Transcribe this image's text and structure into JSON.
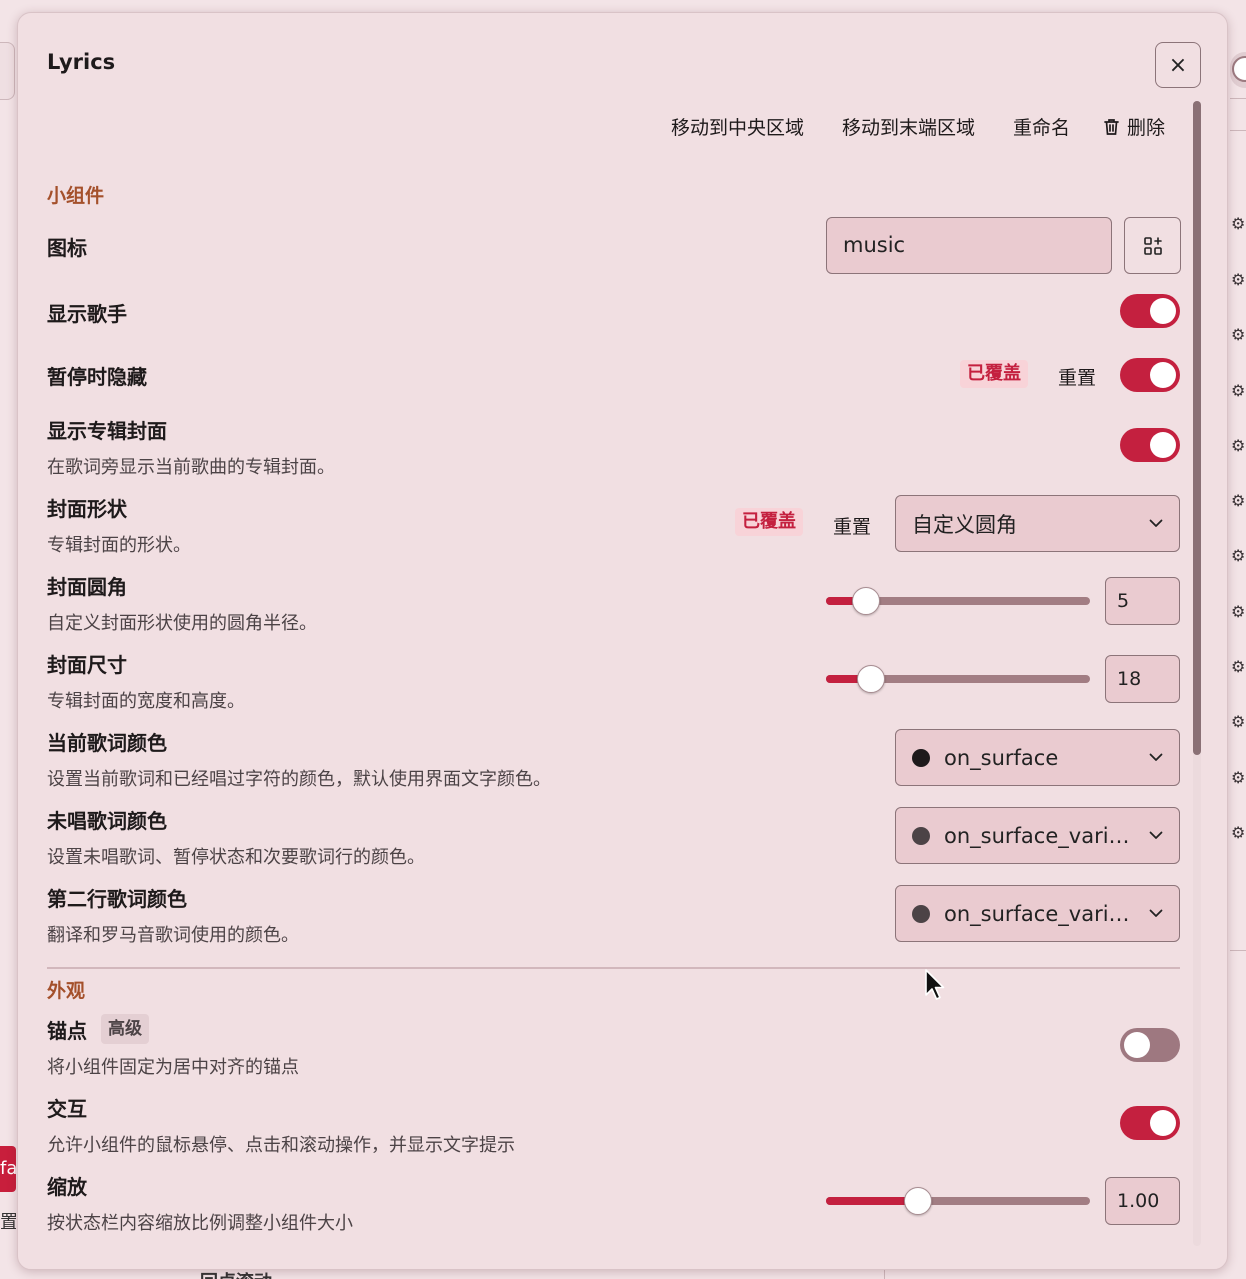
{
  "dialog": {
    "title": "Lyrics",
    "close_label": "×"
  },
  "actions": {
    "move_center": "移动到中央区域",
    "move_end": "移动到末端区域",
    "rename": "重命名",
    "delete": "删除"
  },
  "sections": {
    "widget": "小组件",
    "appearance": "外观"
  },
  "common": {
    "overridden": "已覆盖",
    "reset": "重置"
  },
  "settings": {
    "icon": {
      "label": "图标",
      "value": "music"
    },
    "show_artist": {
      "label": "显示歌手",
      "enabled": true
    },
    "hide_paused": {
      "label": "暂停时隐藏",
      "enabled": true
    },
    "show_cover": {
      "label": "显示专辑封面",
      "desc": "在歌词旁显示当前歌曲的专辑封面。",
      "enabled": true
    },
    "cover_shape": {
      "label": "封面形状",
      "desc": "专辑封面的形状。",
      "value": "自定义圆角"
    },
    "cover_radius": {
      "label": "封面圆角",
      "desc": "自定义封面形状使用的圆角半径。",
      "value": "5",
      "level": 0.15
    },
    "cover_size": {
      "label": "封面尺寸",
      "desc": "专辑封面的宽度和高度。",
      "value": "18",
      "level": 0.17
    },
    "current_color": {
      "label": "当前歌词颜色",
      "desc": "设置当前歌词和已经唱过字符的颜色，默认使用界面文字颜色。",
      "value": "on_surface",
      "swatch": "#1e1a1b"
    },
    "unsung_color": {
      "label": "未唱歌词颜色",
      "desc": "设置未唱歌词、暂停状态和次要歌词行的颜色。",
      "value": "on_surface_vari…",
      "swatch": "#4c4346"
    },
    "second_color": {
      "label": "第二行歌词颜色",
      "desc": "翻译和罗马音歌词使用的颜色。",
      "value": "on_surface_vari…",
      "swatch": "#4c4346"
    },
    "anchor": {
      "label": "锚点",
      "badge": "高级",
      "desc": "将小组件固定为居中对齐的锚点",
      "enabled": false
    },
    "interaction": {
      "label": "交互",
      "desc": "允许小组件的鼠标悬停、点击和滚动操作，并显示文字提示",
      "enabled": true
    },
    "scale": {
      "label": "缩放",
      "desc": "按状态栏内容缩放比例调整小组件大小",
      "value": "1.00",
      "level": 0.35
    }
  },
  "background": {
    "left_red_text": "fa",
    "left_text": "置",
    "bottom_text": "回卓滚动"
  },
  "colors": {
    "accent": "#c4203f",
    "section": "#a4502b",
    "surface": "#f1dfe2"
  }
}
